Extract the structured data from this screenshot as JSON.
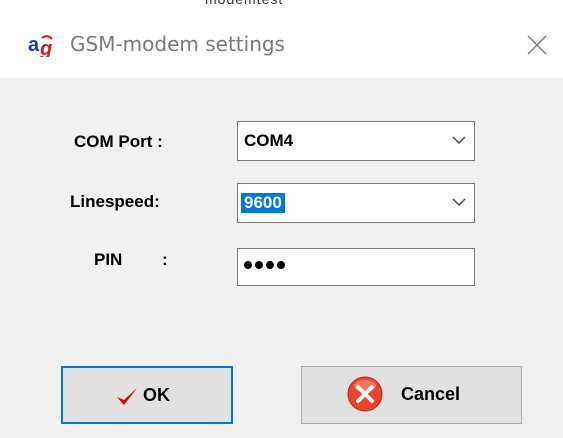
{
  "background_window": {
    "partial_title": "modemtest"
  },
  "window": {
    "title": "GSM-modem settings",
    "app_icon": "ag-app-icon",
    "close_icon": "close-icon"
  },
  "form": {
    "com_port": {
      "label": "COM Port :",
      "value": "COM4"
    },
    "linespeed": {
      "label": "Linespeed:",
      "value": "9600"
    },
    "pin": {
      "label": "PIN",
      "colon": ":",
      "value_masked": true,
      "masked_length": 4
    }
  },
  "buttons": {
    "ok": {
      "label": "OK",
      "icon": "checkmark-icon",
      "is_default": true
    },
    "cancel": {
      "label": "Cancel",
      "icon": "cancel-x-icon"
    }
  },
  "colors": {
    "accent": "#0078d7",
    "dialog_background": "#f0f0f0",
    "checkmark": "#e00000",
    "cancel_icon": "#e8442e"
  }
}
